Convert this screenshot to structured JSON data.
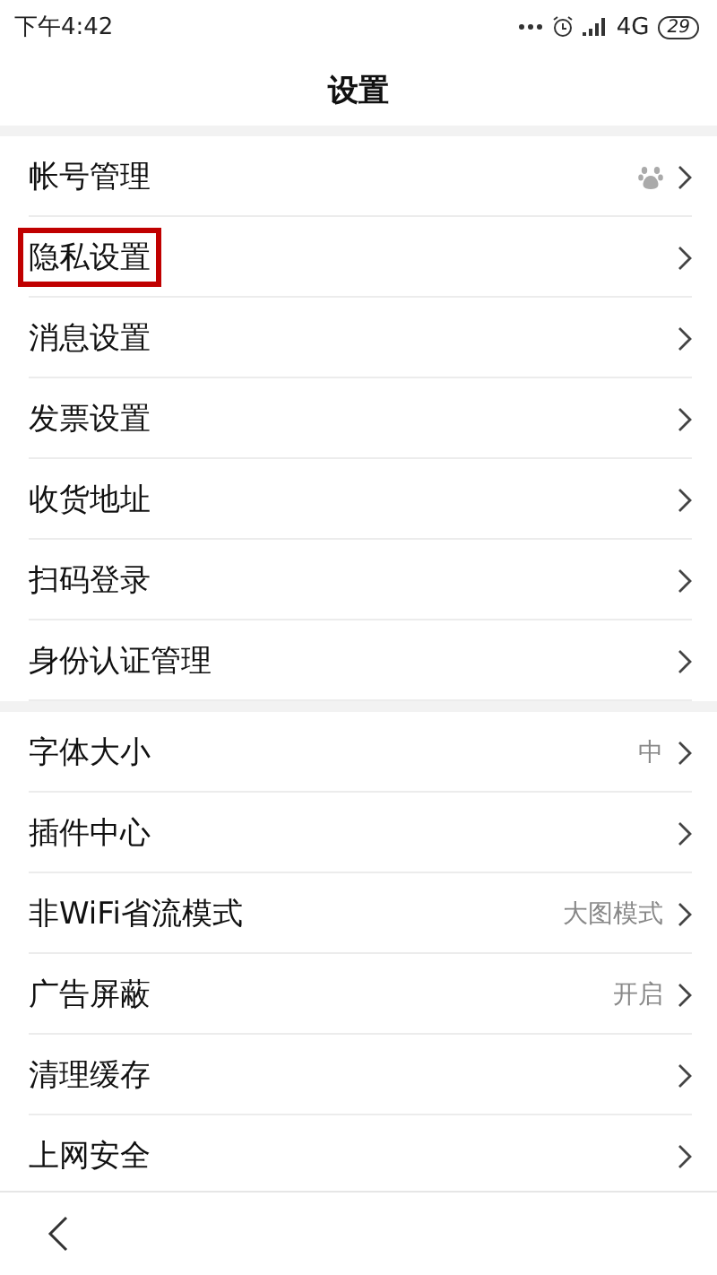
{
  "status_bar": {
    "time": "下午4:42",
    "network": "4G",
    "battery": "29"
  },
  "title": "设置",
  "groups": [
    {
      "items": [
        {
          "label": "帐号管理",
          "kind": "paw",
          "highlighted": false
        },
        {
          "label": "隐私设置",
          "kind": "plain",
          "highlighted": true
        },
        {
          "label": "消息设置",
          "kind": "plain",
          "highlighted": false
        },
        {
          "label": "发票设置",
          "kind": "plain",
          "highlighted": false
        },
        {
          "label": "收货地址",
          "kind": "plain",
          "highlighted": false
        },
        {
          "label": "扫码登录",
          "kind": "plain",
          "highlighted": false
        },
        {
          "label": "身份认证管理",
          "kind": "plain",
          "highlighted": false
        }
      ]
    },
    {
      "items": [
        {
          "label": "字体大小",
          "kind": "value",
          "value": "中",
          "highlighted": false
        },
        {
          "label": "插件中心",
          "kind": "plain",
          "highlighted": false
        },
        {
          "label": "非WiFi省流模式",
          "kind": "value",
          "value": "大图模式",
          "highlighted": false
        },
        {
          "label": "广告屏蔽",
          "kind": "value",
          "value": "开启",
          "highlighted": false
        },
        {
          "label": "清理缓存",
          "kind": "plain",
          "highlighted": false
        },
        {
          "label": "上网安全",
          "kind": "plain",
          "highlighted": false
        }
      ]
    }
  ]
}
